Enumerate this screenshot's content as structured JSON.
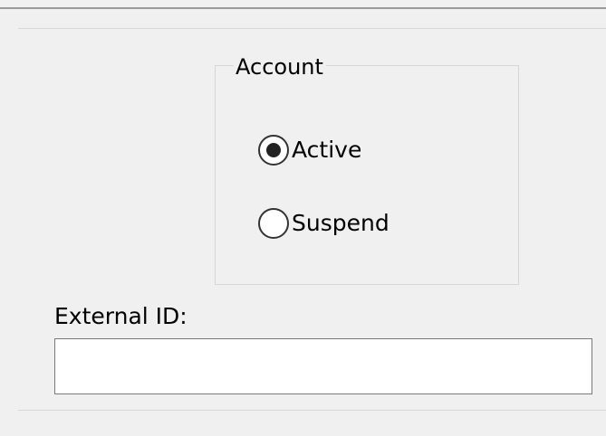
{
  "account_group": {
    "title": "Account",
    "options": [
      {
        "label": "Active",
        "selected": true
      },
      {
        "label": "Suspend",
        "selected": false
      }
    ]
  },
  "external_id": {
    "label": "External ID:",
    "value": ""
  }
}
